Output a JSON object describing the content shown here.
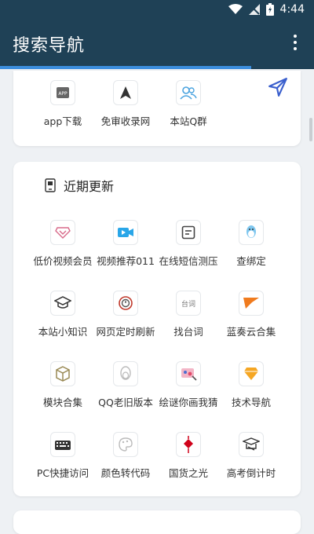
{
  "status": {
    "time": "4:44"
  },
  "appbar": {
    "title": "搜索导航"
  },
  "progress": {
    "value": 0.8
  },
  "section_top": {
    "items": [
      {
        "label": "app下载",
        "icon": "app-download-icon"
      },
      {
        "label": "免审收录网",
        "icon": "navigation-arrow-icon"
      },
      {
        "label": "本站Q群",
        "icon": "group-icon"
      }
    ]
  },
  "section_recent": {
    "title": "近期更新",
    "items": [
      {
        "label": "低价视频会员",
        "icon": "diamond-icon"
      },
      {
        "label": "视频推荐011",
        "icon": "video-camera-icon"
      },
      {
        "label": "在线短信测压",
        "icon": "sms-icon"
      },
      {
        "label": "查绑定",
        "icon": "qq-penguin-icon"
      },
      {
        "label": "本站小知识",
        "icon": "graduation-cap-icon"
      },
      {
        "label": "网页定时刷新",
        "icon": "refresh-clock-icon"
      },
      {
        "label": "找台词",
        "icon": "lines-icon",
        "badge": "台词"
      },
      {
        "label": "蓝奏云合集",
        "icon": "flag-icon"
      },
      {
        "label": "模块合集",
        "icon": "cube-icon"
      },
      {
        "label": "QQ老旧版本",
        "icon": "qq-outline-icon"
      },
      {
        "label": "绘谜你画我猜",
        "icon": "draw-game-icon"
      },
      {
        "label": "技术导航",
        "icon": "gem-icon"
      },
      {
        "label": "PC快捷访问",
        "icon": "keyboard-icon"
      },
      {
        "label": "颜色转代码",
        "icon": "palette-icon"
      },
      {
        "label": "国货之光",
        "icon": "chinese-knot-icon"
      },
      {
        "label": "高考倒计时",
        "icon": "exam-icon"
      }
    ]
  }
}
